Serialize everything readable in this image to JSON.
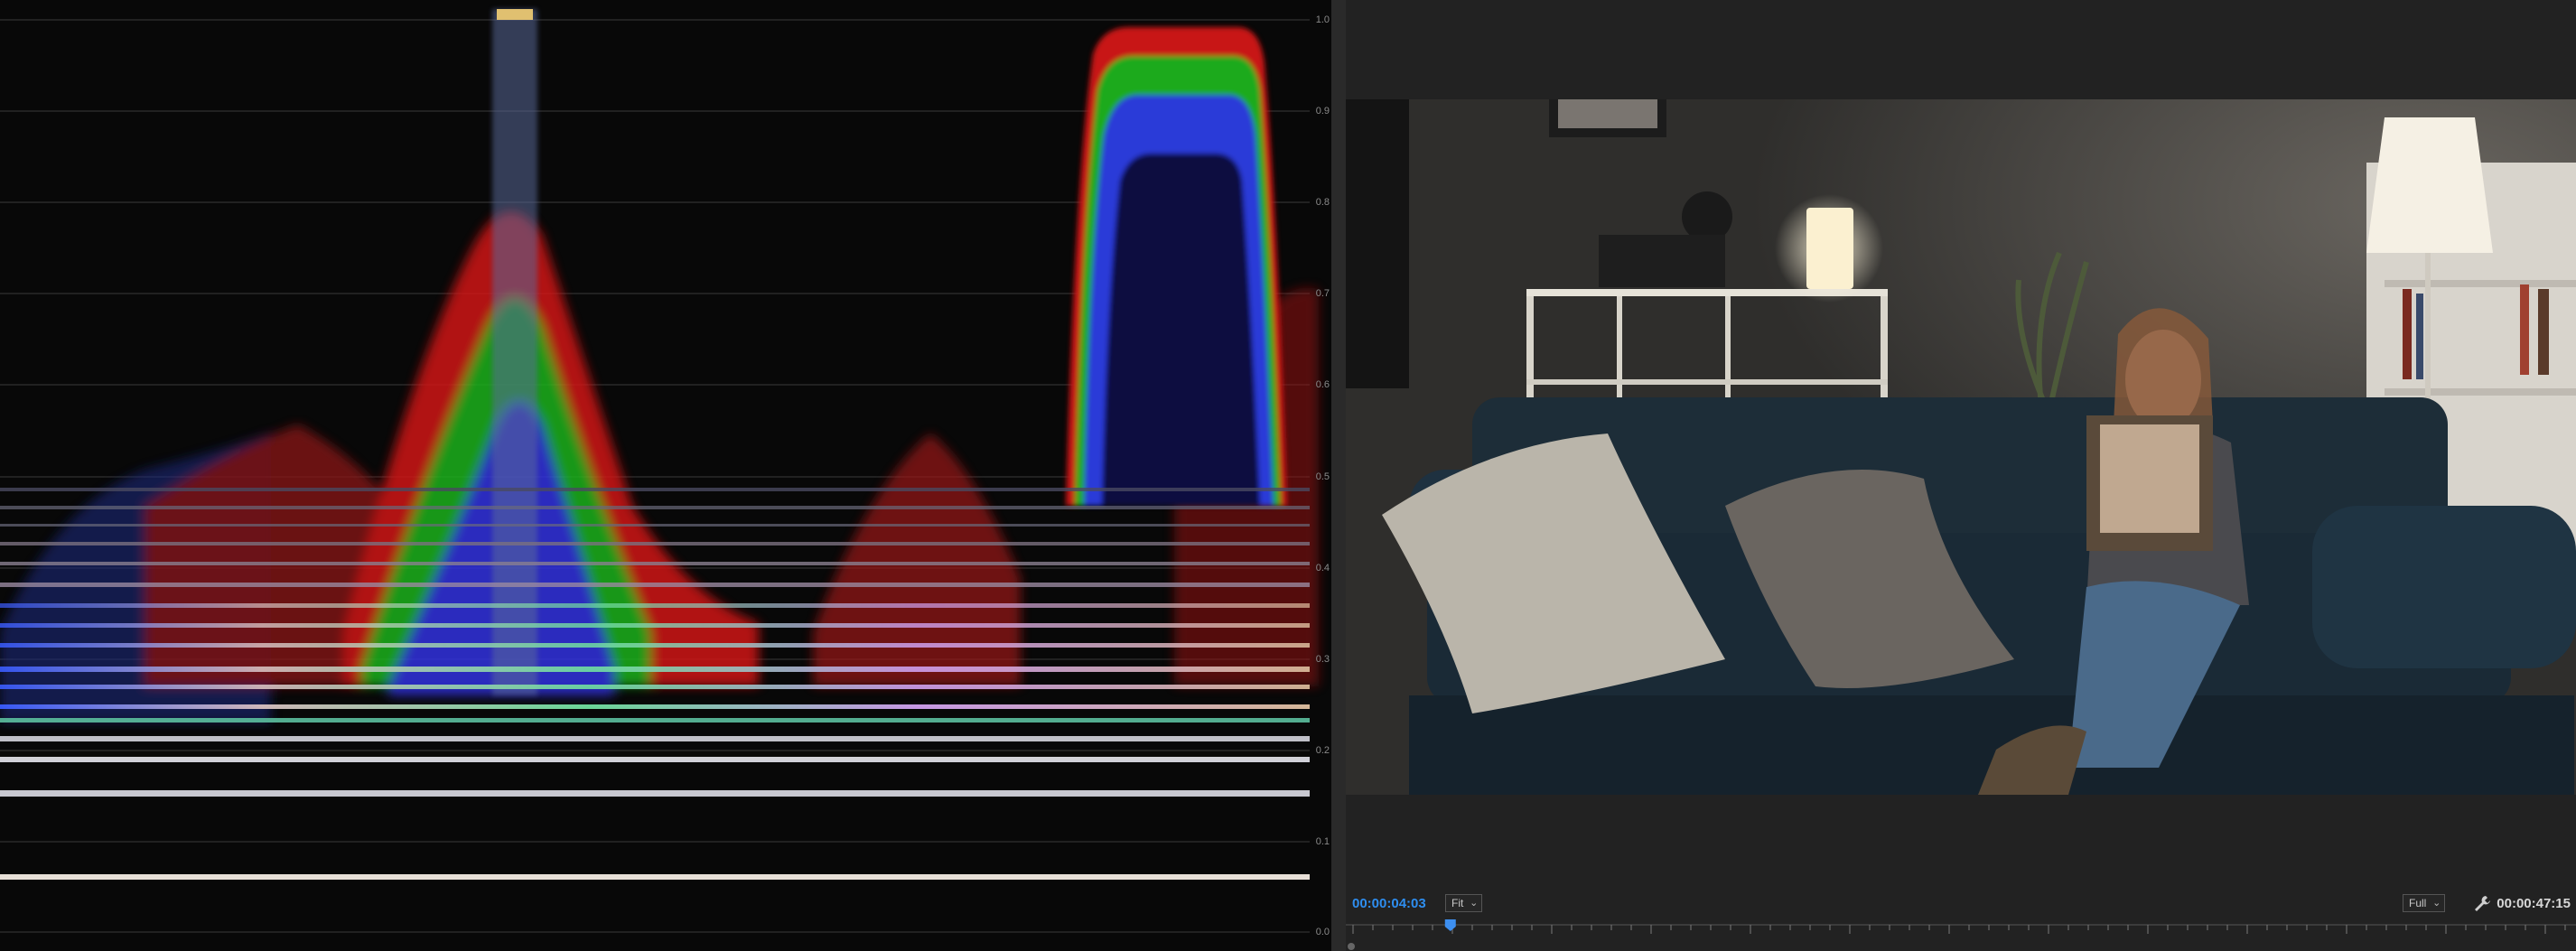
{
  "scope": {
    "name": "RGB Parade Waveform",
    "scale_labels": [
      "1.0",
      "0.9",
      "0.8",
      "0.7",
      "0.6",
      "0.5",
      "0.4",
      "0.3",
      "0.2",
      "0.1",
      "0.0"
    ]
  },
  "monitor": {
    "current_timecode": "00:00:04:03",
    "duration_timecode": "00:00:47:15",
    "zoom_select": "Fit",
    "resolution_select": "Full",
    "playhead_position_fraction": 0.085
  },
  "icons": [
    "chevron-down-icon",
    "wrench-icon",
    "playhead-icon"
  ],
  "colors": {
    "accent": "#2e8ef0",
    "panel_bg": "#222222",
    "scope_bg": "#080808"
  }
}
